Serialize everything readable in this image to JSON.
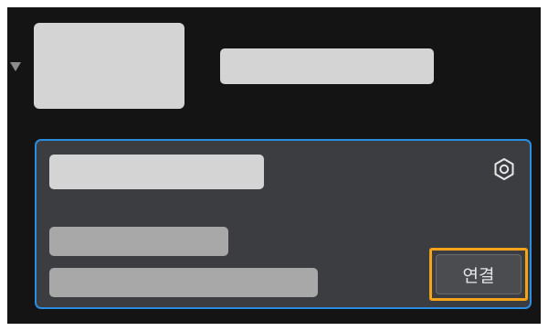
{
  "device_list": {
    "expanded": true,
    "group_header": {
      "thumbnail_icon": "device-thumbnail-placeholder",
      "name": ""
    },
    "device_card": {
      "selected": true,
      "name": "",
      "info_line_1": "",
      "info_line_2": "",
      "settings_icon": "settings-hexagon-icon",
      "connect_label": "연결",
      "connect_highlighted": true
    }
  },
  "colors": {
    "background": "#141414",
    "card_background": "#3c3d40",
    "selection_border": "#2a8de0",
    "highlight_border": "#f5a31a",
    "placeholder_light": "#d4d4d4",
    "placeholder_mid": "#a8a8a8"
  }
}
